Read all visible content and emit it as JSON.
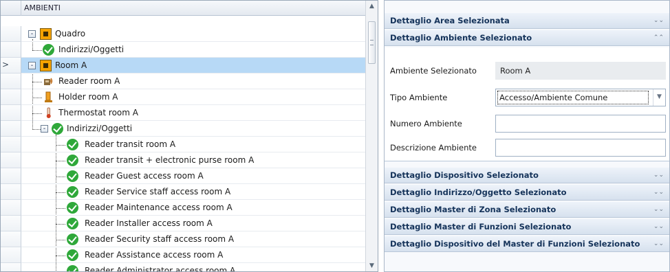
{
  "tree": {
    "header": "AMBIENTI",
    "rows": [
      {
        "label": "Quadro",
        "icon": "box-icon",
        "expander": "-"
      },
      {
        "label": "Indirizzi/Oggetti",
        "icon": "check-icon",
        "expander": ""
      },
      {
        "label": "Room A",
        "icon": "box-icon",
        "expander": "-",
        "selected": true,
        "pointer": ">"
      },
      {
        "label": "Reader room A",
        "icon": "reader-icon",
        "expander": ""
      },
      {
        "label": "Holder room A",
        "icon": "holder-icon",
        "expander": ""
      },
      {
        "label": "Thermostat room A",
        "icon": "thermostat-icon",
        "expander": ""
      },
      {
        "label": "Indirizzi/Oggetti",
        "icon": "check-icon",
        "expander": "-"
      },
      {
        "label": "Reader transit room A",
        "icon": "check-icon",
        "expander": ""
      },
      {
        "label": "Reader transit + electronic purse room A",
        "icon": "check-icon",
        "expander": ""
      },
      {
        "label": "Reader Guest access room A",
        "icon": "check-icon",
        "expander": ""
      },
      {
        "label": "Reader Service staff access room A",
        "icon": "check-icon",
        "expander": ""
      },
      {
        "label": "Reader Maintenance access room A",
        "icon": "check-icon",
        "expander": ""
      },
      {
        "label": "Reader Installer access room A",
        "icon": "check-icon",
        "expander": ""
      },
      {
        "label": "Reader Security staff access room A",
        "icon": "check-icon",
        "expander": ""
      },
      {
        "label": "Reader Assistance access room A",
        "icon": "check-icon",
        "expander": ""
      },
      {
        "label": "Reader Administrator access room A",
        "icon": "check-icon",
        "expander": ""
      }
    ]
  },
  "panel": {
    "sections_top": [
      {
        "title": "Dettaglio Area Selezionata",
        "chevron": "⌄⌄"
      },
      {
        "title": "Dettaglio Ambiente Selezionato",
        "chevron": "⌃⌃"
      }
    ],
    "form": {
      "ambiente_label": "Ambiente Selezionato",
      "ambiente_value": "Room A",
      "tipo_label": "Tipo Ambiente",
      "tipo_value": "Accesso/Ambiente Comune",
      "numero_label": "Numero Ambiente",
      "numero_value": "",
      "descrizione_label": "Descrizione Ambiente",
      "descrizione_value": ""
    },
    "sections_bottom": [
      {
        "title": "Dettaglio Dispositivo Selezionato",
        "chevron": "⌄⌄"
      },
      {
        "title": "Dettaglio Indirizzo/Oggetto Selezionato",
        "chevron": "⌄⌄"
      },
      {
        "title": "Dettaglio Master di Zona Selezionato",
        "chevron": "⌄⌄"
      },
      {
        "title": "Dettaglio Master di Funzioni Selezionato",
        "chevron": "⌄⌄"
      },
      {
        "title": "Dettaglio Dispositivo del Master di Funzioni Selezionato",
        "chevron": "⌄⌄"
      }
    ]
  }
}
